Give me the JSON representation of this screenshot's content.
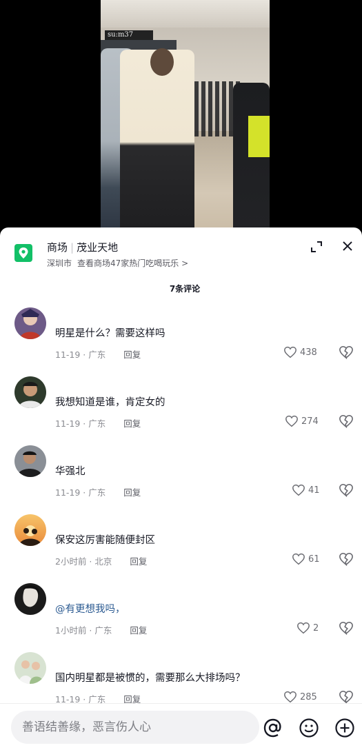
{
  "video": {
    "store_sign": "su:m37"
  },
  "location": {
    "category": "商场",
    "name": "茂业天地",
    "city": "深圳市",
    "subtitle": "查看商场47家热门吃喝玩乐 >",
    "icon": "map-pin-icon"
  },
  "comments_header": {
    "count_label": "7条评论"
  },
  "comments": [
    {
      "text": "明星是什么？需要这样吗",
      "time": "11-19",
      "region": "广东",
      "reply_label": "回复",
      "likes": "438",
      "mention": false
    },
    {
      "text": "我想知道是谁，肯定女的",
      "time": "11-19",
      "region": "广东",
      "reply_label": "回复",
      "likes": "274",
      "mention": false
    },
    {
      "text": "华强北",
      "time": "11-19",
      "region": "广东",
      "reply_label": "回复",
      "likes": "41",
      "mention": false
    },
    {
      "text": "保安这厉害能随便封区",
      "time": "2小时前",
      "region": "北京",
      "reply_label": "回复",
      "likes": "61",
      "mention": false
    },
    {
      "text": "@有更想我吗，",
      "time": "1小时前",
      "region": "广东",
      "reply_label": "回复",
      "likes": "2",
      "mention": true
    },
    {
      "text": "国内明星都是被惯的，需要那么大排场吗？",
      "time": "11-19",
      "region": "广东",
      "reply_label": "回复",
      "likes": "285",
      "mention": false
    }
  ],
  "meta_separator": " · ",
  "input": {
    "placeholder": "善语结善缘，恶言伤人心"
  },
  "icons": {
    "expand": "expand-icon",
    "close": "close-icon",
    "like": "heart-icon",
    "dislike": "broken-heart-icon",
    "mention": "at-icon",
    "emoji": "emoji-icon",
    "add": "plus-icon"
  },
  "colors": {
    "location_green": "#12c067",
    "mention_blue": "#2b5a91",
    "text_primary": "#161823",
    "text_secondary": "#8a8b91"
  }
}
